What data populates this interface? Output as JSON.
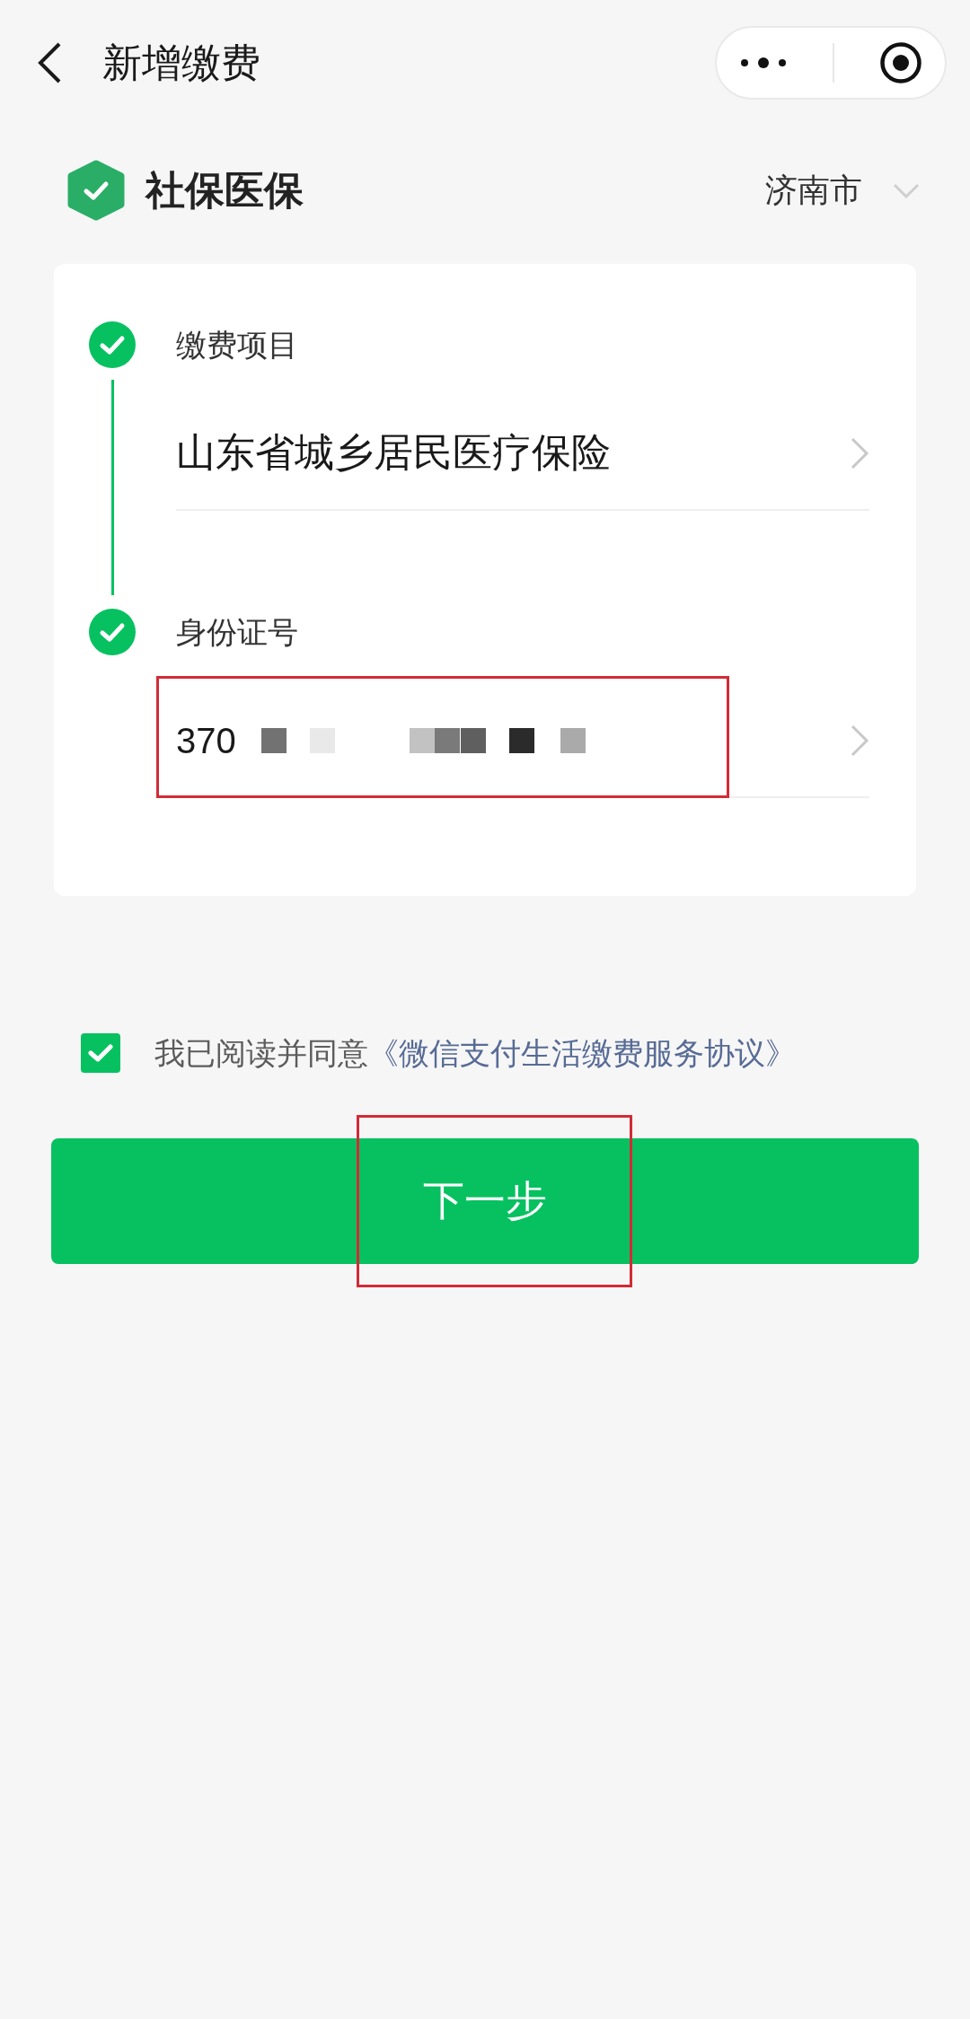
{
  "nav": {
    "title": "新增缴费"
  },
  "header": {
    "title": "社保医保",
    "city": "济南市"
  },
  "steps": [
    {
      "label": "缴费项目",
      "value": "山东省城乡居民医疗保险",
      "done": true,
      "redacted": false,
      "highlighted": false
    },
    {
      "label": "身份证号",
      "value": "370",
      "done": true,
      "redacted": true,
      "highlighted": true
    }
  ],
  "agreement": {
    "checked": true,
    "text": "我已阅读并同意",
    "link": "《微信支付生活缴费服务协议》"
  },
  "next_button": {
    "label": "下一步",
    "highlighted": true
  }
}
